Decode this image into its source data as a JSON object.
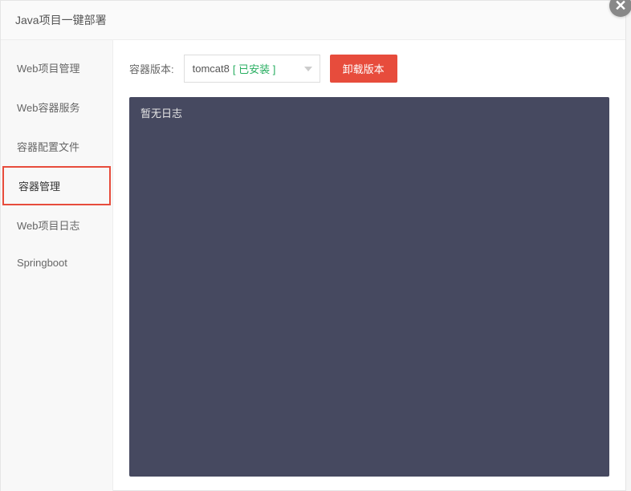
{
  "header": {
    "title": "Java项目一键部署"
  },
  "sidebar": {
    "items": [
      {
        "label": "Web项目管理",
        "active": false
      },
      {
        "label": "Web容器服务",
        "active": false
      },
      {
        "label": "容器配置文件",
        "active": false
      },
      {
        "label": "容器管理",
        "active": true
      },
      {
        "label": "Web项目日志",
        "active": false
      },
      {
        "label": "Springboot",
        "active": false
      }
    ]
  },
  "toolbar": {
    "version_label": "容器版本:",
    "selected_version": "tomcat8",
    "installed_tag": "[ 已安装 ]",
    "uninstall_label": "卸载版本"
  },
  "log": {
    "empty_text": "暂无日志"
  }
}
